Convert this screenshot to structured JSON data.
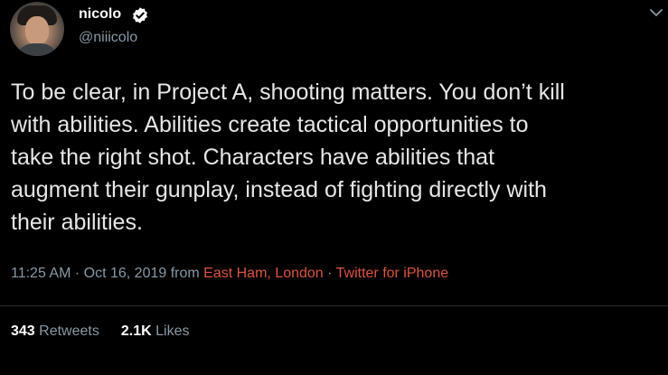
{
  "author": {
    "display_name": "nicolo",
    "handle": "@niiicolo",
    "verified_icon": "verified-badge-icon",
    "avatar_icon": "avatar"
  },
  "menu": {
    "icon": "chevron-down-icon"
  },
  "tweet": {
    "text": "To be clear, in Project A, shooting matters. You don’t kill\nwith abilities. Abilities create tactical opportunities to\ntake the right shot. Characters have abilities that\naugment their gunplay, instead of fighting directly with\ntheir abilities."
  },
  "meta": {
    "time": "11:25 AM",
    "separator1": " · ",
    "date": "Oct 16, 2019",
    "from_word": " from ",
    "location": "East Ham, London",
    "separator2": " · ",
    "source": "Twitter for iPhone"
  },
  "stats": {
    "retweets_count": "343",
    "retweets_label": "Retweets",
    "likes_count": "2.1K",
    "likes_label": "Likes"
  },
  "colors": {
    "background": "#000000",
    "link": "#e0533c",
    "muted": "#8899a6",
    "text": "#e6e6e6"
  }
}
